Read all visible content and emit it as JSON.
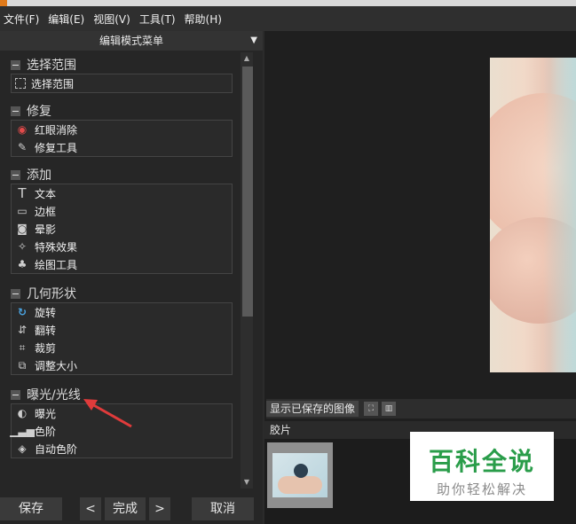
{
  "menu": [
    "文件(F)",
    "编辑(E)",
    "视图(V)",
    "工具(T)",
    "帮助(H)"
  ],
  "panel": {
    "title": "编辑模式菜单",
    "sections": [
      {
        "title": "选择范围",
        "items": [
          {
            "label": "选择范围",
            "icon": "selection-icon"
          }
        ]
      },
      {
        "title": "修复",
        "items": [
          {
            "label": "红眼消除",
            "icon": "redeye-icon"
          },
          {
            "label": "修复工具",
            "icon": "repair-icon"
          }
        ]
      },
      {
        "title": "添加",
        "items": [
          {
            "label": "文本",
            "icon": "text-icon"
          },
          {
            "label": "边框",
            "icon": "border-icon"
          },
          {
            "label": "晕影",
            "icon": "vignette-icon"
          },
          {
            "label": "特殊效果",
            "icon": "effects-icon"
          },
          {
            "label": "绘图工具",
            "icon": "draw-icon"
          }
        ]
      },
      {
        "title": "几何形状",
        "items": [
          {
            "label": "旋转",
            "icon": "rotate-icon"
          },
          {
            "label": "翻转",
            "icon": "flip-icon"
          },
          {
            "label": "裁剪",
            "icon": "crop-icon"
          },
          {
            "label": "调整大小",
            "icon": "resize-icon"
          }
        ]
      },
      {
        "title": "曝光/光线",
        "items": [
          {
            "label": "曝光",
            "icon": "exposure-icon"
          },
          {
            "label": "色阶",
            "icon": "levels-icon"
          },
          {
            "label": "自动色阶",
            "icon": "auto-levels-icon"
          }
        ]
      }
    ]
  },
  "buttons": {
    "save": "保存",
    "prev": "<",
    "done": "完成",
    "next": ">",
    "cancel": "取消"
  },
  "saved_images_label": "显示已保存的图像",
  "film_label": "胶片",
  "watermark": {
    "line1": "百科全说",
    "line2": "助你轻松解决"
  },
  "colors": {
    "annotation_arrow": "#e03b3b",
    "watermark_green": "#2a9d4a"
  }
}
